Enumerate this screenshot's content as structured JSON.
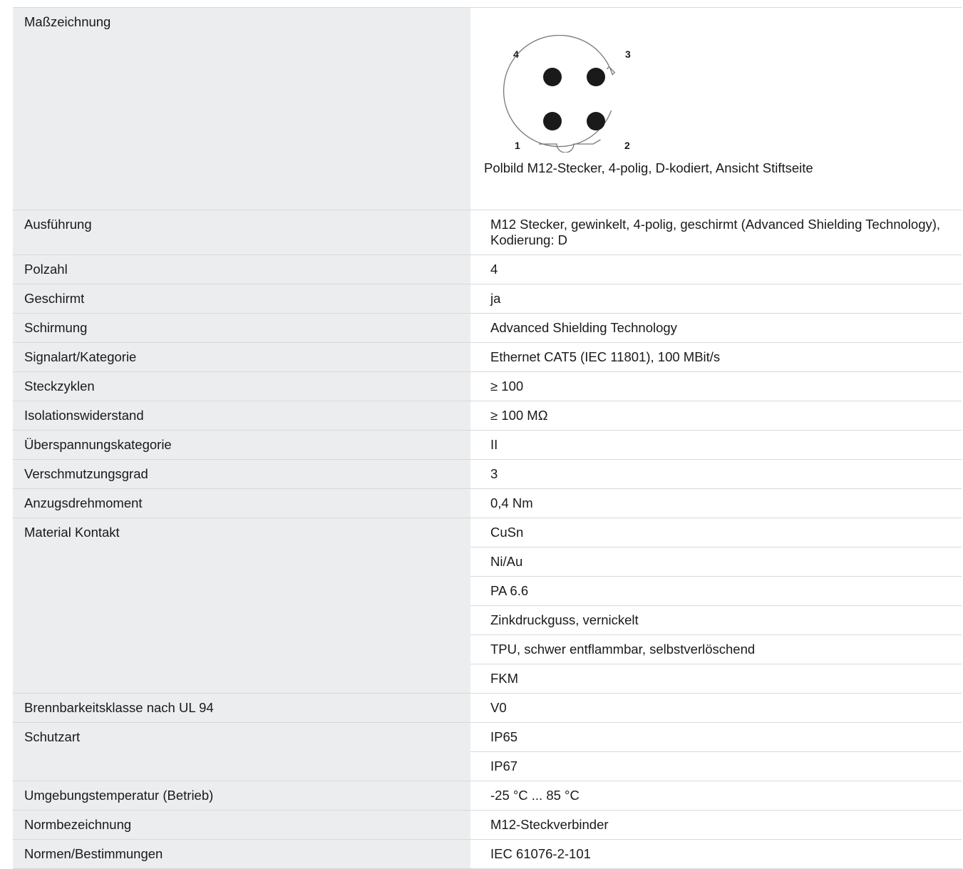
{
  "drawing": {
    "label": "Maßzeichnung",
    "pin_labels": [
      "4",
      "3",
      "1",
      "2"
    ],
    "caption": "Polbild M12-Stecker, 4-polig, D-kodiert, Ansicht Stiftseite"
  },
  "rows": [
    {
      "label": "Ausführung",
      "values": [
        "M12 Stecker, gewinkelt, 4-polig, geschirmt (Advanced Shielding Technology), Kodierung: D"
      ]
    },
    {
      "label": "Polzahl",
      "values": [
        "4"
      ]
    },
    {
      "label": "Geschirmt",
      "values": [
        "ja"
      ]
    },
    {
      "label": "Schirmung",
      "values": [
        "Advanced Shielding Technology"
      ]
    },
    {
      "label": "Signalart/Kategorie",
      "values": [
        "Ethernet CAT5 (IEC 11801), 100 MBit/s"
      ]
    },
    {
      "label": "Steckzyklen",
      "values": [
        "≥ 100"
      ]
    },
    {
      "label": "Isolationswiderstand",
      "values": [
        "≥ 100 MΩ"
      ]
    },
    {
      "label": "Überspannungskategorie",
      "values": [
        "II"
      ]
    },
    {
      "label": "Verschmutzungsgrad",
      "values": [
        "3"
      ]
    },
    {
      "label": "Anzugsdrehmoment",
      "values": [
        "0,4 Nm"
      ]
    },
    {
      "label": "Material Kontakt",
      "values": [
        "CuSn",
        "Ni/Au",
        "PA 6.6",
        "Zinkdruckguss, vernickelt",
        "TPU, schwer entflammbar, selbstverlöschend",
        "FKM"
      ]
    },
    {
      "label": "Brennbarkeitsklasse nach UL 94",
      "values": [
        "V0"
      ]
    },
    {
      "label": "Schutzart",
      "values": [
        "IP65",
        "IP67"
      ]
    },
    {
      "label": "Umgebungstemperatur (Betrieb)",
      "values": [
        "-25 °C ... 85 °C"
      ]
    },
    {
      "label": "Normbezeichnung",
      "values": [
        "M12-Steckverbinder"
      ]
    },
    {
      "label": "Normen/Bestimmungen",
      "values": [
        "IEC 61076-2-101"
      ]
    }
  ]
}
